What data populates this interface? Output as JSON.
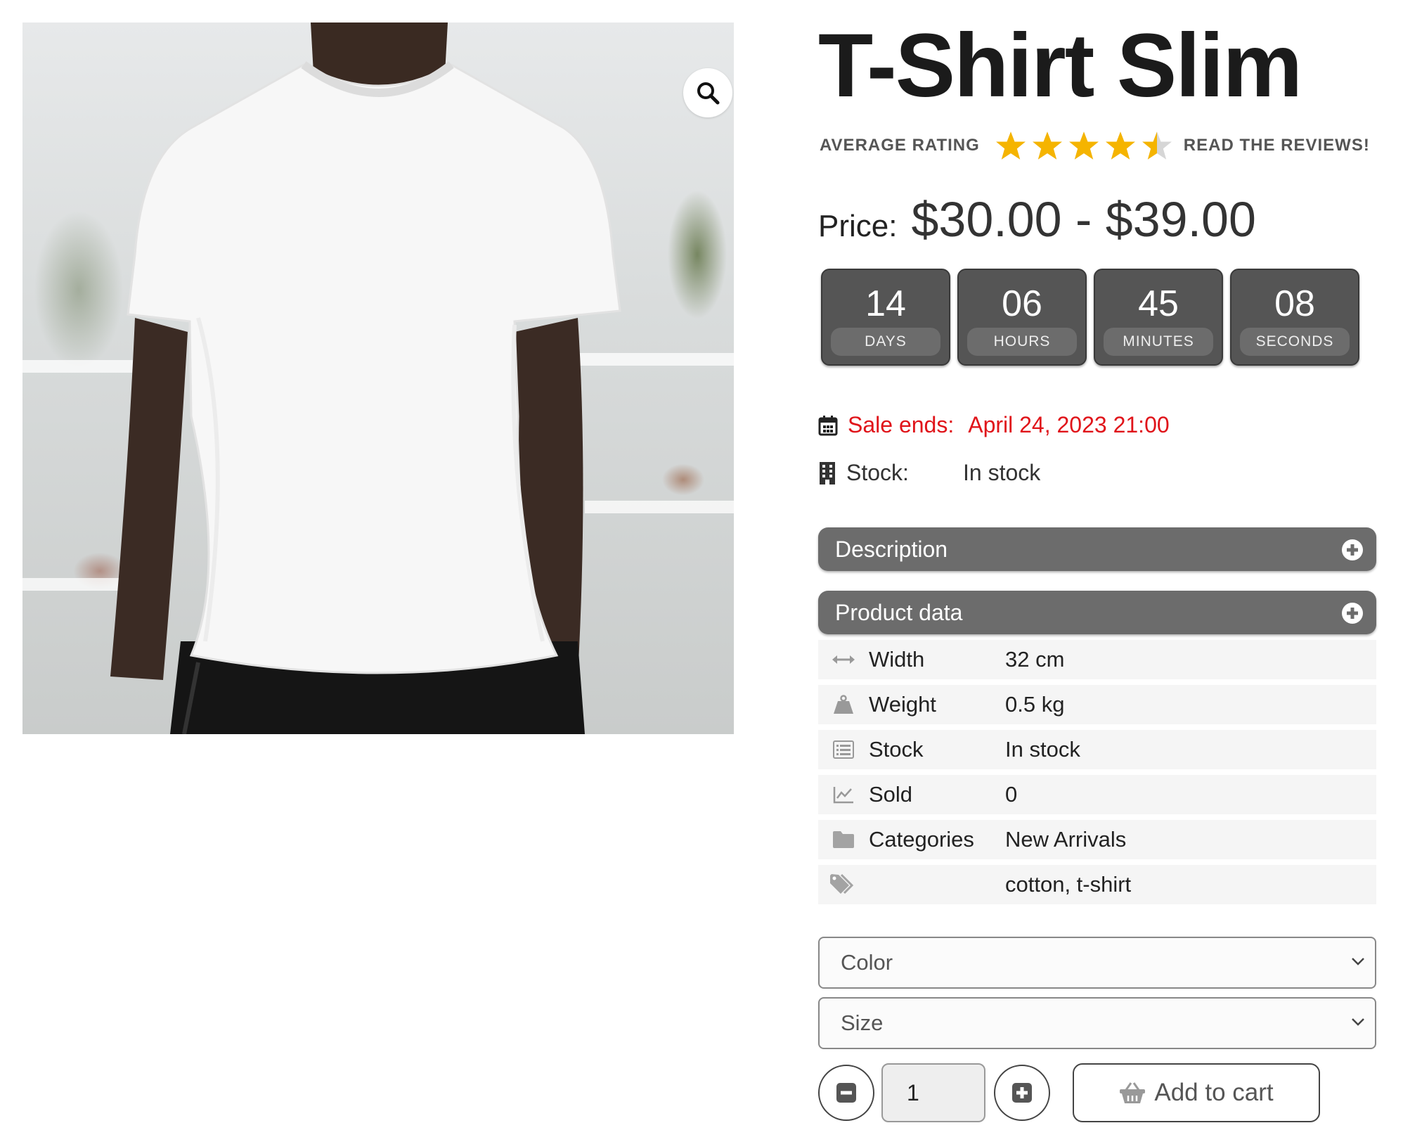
{
  "product": {
    "title": "T-Shirt Slim",
    "rating": {
      "label": "AVERAGE RATING",
      "value": 4.5,
      "max": 5,
      "reviews_link": "READ THE REVIEWS!"
    },
    "price": {
      "label": "Price:",
      "value": "$30.00 - $39.00"
    }
  },
  "countdown": [
    {
      "value": "14",
      "unit": "DAYS"
    },
    {
      "value": "06",
      "unit": "HOURS"
    },
    {
      "value": "45",
      "unit": "MINUTES"
    },
    {
      "value": "08",
      "unit": "SECONDS"
    }
  ],
  "sale": {
    "label": "Sale ends:",
    "date": "April 24, 2023 21:00"
  },
  "stock": {
    "label": "Stock:",
    "value": "In stock"
  },
  "accordion": {
    "description": "Description",
    "product_data": "Product data"
  },
  "product_data": [
    {
      "icon": "arrows-horizontal-icon",
      "key": "Width",
      "value": "32 cm"
    },
    {
      "icon": "weight-icon",
      "key": "Weight",
      "value": "0.5 kg"
    },
    {
      "icon": "list-icon",
      "key": "Stock",
      "value": "In stock"
    },
    {
      "icon": "chart-line-icon",
      "key": "Sold",
      "value": "0"
    },
    {
      "icon": "folder-icon",
      "key": "Categories",
      "value": "New Arrivals"
    },
    {
      "icon": "tags-icon",
      "key": "",
      "value": "cotton, t-shirt"
    }
  ],
  "options": {
    "color_placeholder": "Color",
    "size_placeholder": "Size"
  },
  "cart": {
    "quantity": "1",
    "add_label": "Add to cart"
  },
  "colors": {
    "sale_red": "#e0141a",
    "star_gold": "#f5b400",
    "accordion_gray": "#6c6c6c",
    "countdown_gray": "#555555"
  }
}
